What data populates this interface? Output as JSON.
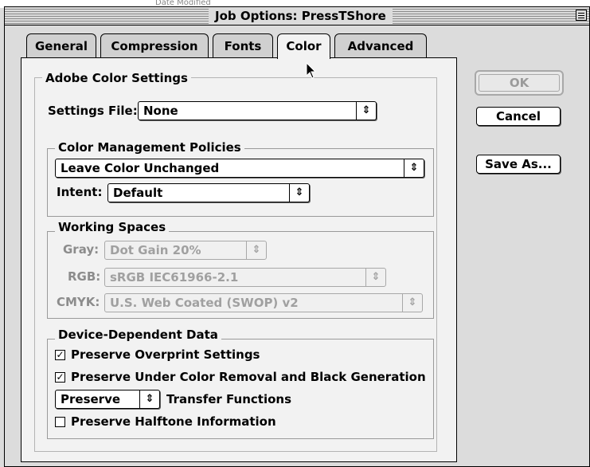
{
  "window": {
    "title": "Job Options: PressTShore",
    "background_fragment": "Date Modified"
  },
  "tabs": [
    {
      "label": "General",
      "active": false
    },
    {
      "label": "Compression",
      "active": false
    },
    {
      "label": "Fonts",
      "active": false
    },
    {
      "label": "Color",
      "active": true
    },
    {
      "label": "Advanced",
      "active": false
    }
  ],
  "adobe_color_settings": {
    "title": "Adobe Color Settings",
    "settings_file_label": "Settings File:",
    "settings_file_value": "None"
  },
  "color_management": {
    "title": "Color Management Policies",
    "policy_value": "Leave Color Unchanged",
    "intent_label": "Intent:",
    "intent_value": "Default"
  },
  "working_spaces": {
    "title": "Working Spaces",
    "gray_label": "Gray:",
    "gray_value": "Dot Gain 20%",
    "rgb_label": "RGB:",
    "rgb_value": "sRGB IEC61966-2.1",
    "cmyk_label": "CMYK:",
    "cmyk_value": "U.S. Web Coated (SWOP) v2"
  },
  "device_dependent": {
    "title": "Device-Dependent Data",
    "overprint_label": "Preserve Overprint Settings",
    "overprint_checked": true,
    "ucr_label": "Preserve Under Color Removal and Black Generation",
    "ucr_checked": true,
    "transfer_value": "Preserve",
    "transfer_label": "Transfer Functions",
    "halftone_label": "Preserve Halftone Information",
    "halftone_checked": false
  },
  "buttons": {
    "ok": "OK",
    "cancel": "Cancel",
    "save_as": "Save As..."
  },
  "icons": {
    "popup_arrow": "up-down-arrows-icon",
    "checkmark": "checkmark-icon",
    "zoom_box": "window-zoom-icon",
    "cursor": "mouse-pointer-icon"
  }
}
